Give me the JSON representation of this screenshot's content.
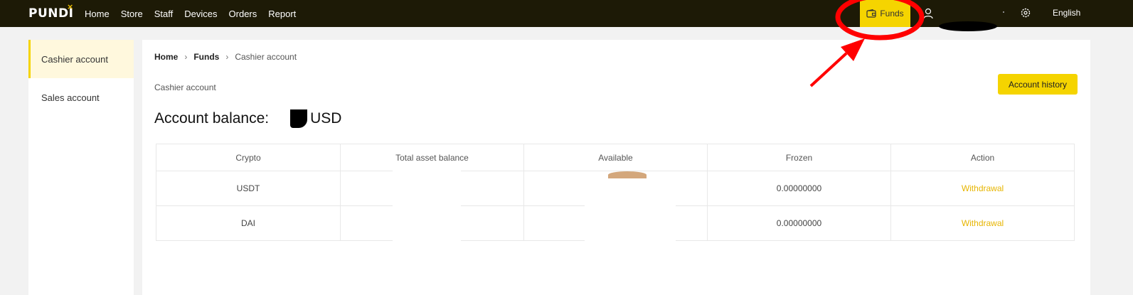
{
  "topbar": {
    "logo": "PUNDI",
    "logo_mark": "×",
    "nav": [
      "Home",
      "Store",
      "Staff",
      "Devices",
      "Orders",
      "Report"
    ],
    "funds_label": "Funds",
    "language": "English"
  },
  "sidebar": {
    "items": [
      {
        "label": "Cashier account",
        "active": true
      },
      {
        "label": "Sales account",
        "active": false
      }
    ]
  },
  "main": {
    "breadcrumb": [
      "Home",
      "Funds",
      "Cashier account"
    ],
    "subtitle": "Cashier account",
    "history_button": "Account history",
    "balance_label": "Account balance:",
    "balance_currency": "USD"
  },
  "table": {
    "headers": [
      "Crypto",
      "Total asset balance",
      "Available",
      "Frozen",
      "Action"
    ],
    "rows": [
      {
        "crypto": "USDT",
        "total": "",
        "available": "",
        "frozen": "0.00000000",
        "action": "Withdrawal"
      },
      {
        "crypto": "DAI",
        "total": "",
        "available": "",
        "frozen": "0.00000000",
        "action": "Withdrawal"
      }
    ]
  },
  "colors": {
    "accent": "#f5d400",
    "topbar": "#1d1a06",
    "annotation": "#ff0000"
  }
}
